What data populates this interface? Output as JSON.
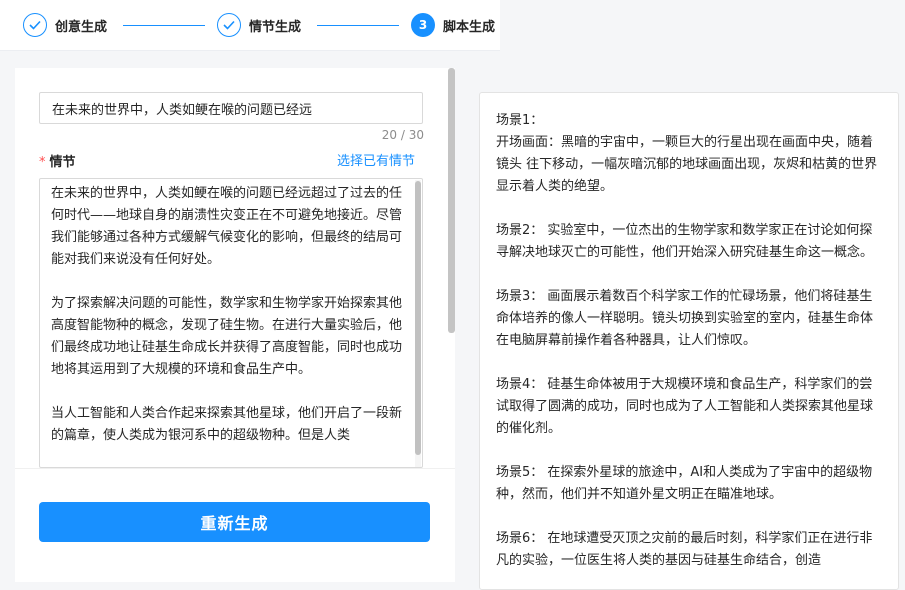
{
  "steps": [
    {
      "label": "创意生成",
      "state": "done"
    },
    {
      "label": "情节生成",
      "state": "done"
    },
    {
      "label": "脚本生成",
      "state": "active",
      "number": "3"
    }
  ],
  "title_field": {
    "value": "在未来的世界中，人类如鲠在喉的问题已经远",
    "counter": "20 / 30"
  },
  "plot": {
    "required_mark": "*",
    "label": "情节",
    "select_link": "选择已有情节",
    "text": "在未来的世界中，人类如鲠在喉的问题已经远超过了过去的任何时代——地球自身的崩溃性灾变正在不可避免地接近。尽管我们能够通过各种方式缓解气候变化的影响，但最终的结局可能对我们来说没有任何好处。\n\n为了探索解决问题的可能性，数学家和生物学家开始探索其他高度智能物种的概念，发现了硅生物。在进行大量实验后，他们最终成功地让硅基生命成长并获得了高度智能，同时也成功地将其运用到了大规模的环境和食品生产中。\n\n当人工智能和人类合作起来探索其他星球，他们开启了一段新的篇章，使人类成为银河系中的超级物种。但是人类"
  },
  "regenerate_button": "重新生成",
  "script": {
    "text": "场景1：\n开场画面：黑暗的宇宙中，一颗巨大的行星出现在画面中央，随着镜头 往下移动，一幅灰暗沉郁的地球画面出现，灰烬和枯黄的世界显示着人类的绝望。\n\n场景2： 实验室中，一位杰出的生物学家和数学家正在讨论如何探寻解决地球灭亡的可能性，他们开始深入研究硅基生命这一概念。\n\n场景3： 画面展示着数百个科学家工作的忙碌场景，他们将硅基生命体培养的像人一样聪明。镜头切换到实验室的室内，硅基生命体在电脑屏幕前操作着各种器具，让人们惊叹。\n\n场景4： 硅基生命体被用于大规模环境和食品生产，科学家们的尝试取得了圆满的成功，同时也成为了人工智能和人类探索其他星球的催化剂。\n\n场景5： 在探索外星球的旅途中，AI和人类成为了宇宙中的超级物种，然而，他们并不知道外星文明正在瞄准地球。\n\n场景6： 在地球遭受灭顶之灾前的最后时刻，科学家们正在进行非凡的实验，一位医生将人类的基因与硅基生命结合，创造"
  },
  "colors": {
    "accent": "#1890ff",
    "required": "#ff4d4f",
    "background": "#f5f6f8"
  },
  "icons": {
    "done_step": "check-icon"
  }
}
